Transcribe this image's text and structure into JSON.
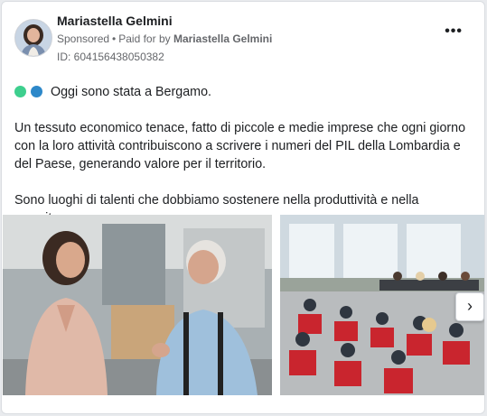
{
  "post": {
    "author": "Mariastella Gelmini",
    "sponsored_label": "Sponsored",
    "separator": "•",
    "paid_for_prefix": "Paid for by",
    "paid_for_by": "Mariastella Gelmini",
    "ad_id": "ID: 604156438050382",
    "more_icon": "more-options-icon",
    "paragraphs": [
      "Oggi sono stata a Bergamo.",
      "Un tessuto economico tenace, fatto di piccole e medie imprese che ogni giorno con la loro attività contribuiscono a scrivere i numeri del PIL della Lombardia e del Paese, generando valore per il territorio.",
      "Sono luoghi di talenti che dobbiamo sostenere nella produttività e nella crescita,…"
    ],
    "emoji_colors": [
      "#3ecf8e",
      "#2d88c9"
    ]
  },
  "carousel": {
    "next_icon": "chevron-right-icon",
    "next_glyph": "›",
    "slides": [
      "factory-visit-photo",
      "conference-room-photo"
    ]
  },
  "colors": {
    "primary_text": "#1c1e21",
    "secondary_text": "#65676b",
    "card_bg": "#ffffff",
    "page_bg": "#e9ebee"
  }
}
